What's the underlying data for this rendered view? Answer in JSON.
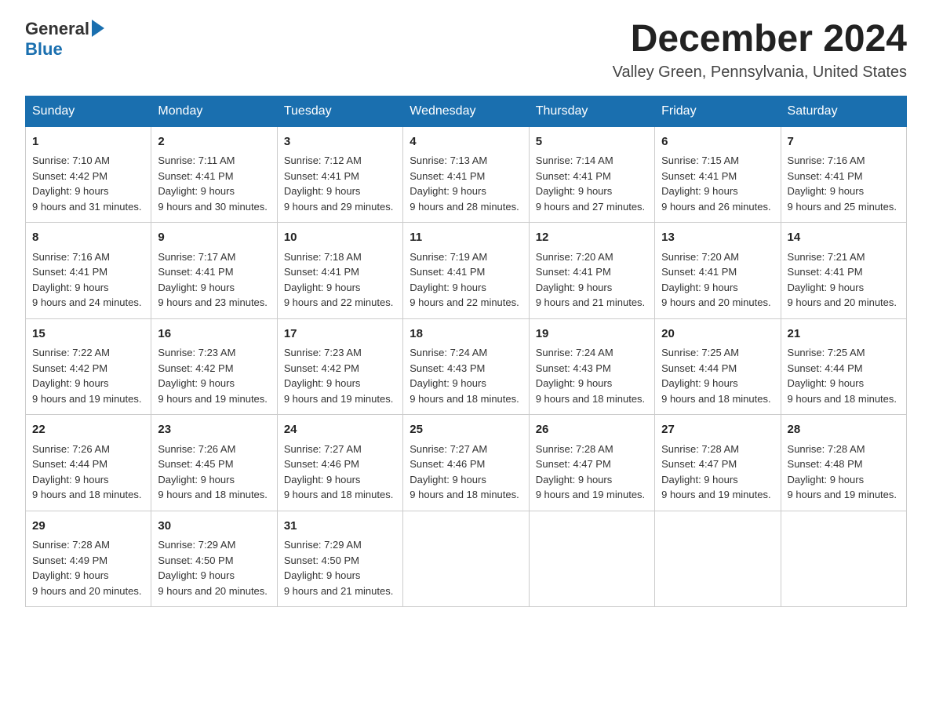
{
  "header": {
    "logo_general": "General",
    "logo_blue": "Blue",
    "month_title": "December 2024",
    "location": "Valley Green, Pennsylvania, United States"
  },
  "days_of_week": [
    "Sunday",
    "Monday",
    "Tuesday",
    "Wednesday",
    "Thursday",
    "Friday",
    "Saturday"
  ],
  "weeks": [
    [
      {
        "day": "1",
        "sunrise": "7:10 AM",
        "sunset": "4:42 PM",
        "daylight": "9 hours and 31 minutes."
      },
      {
        "day": "2",
        "sunrise": "7:11 AM",
        "sunset": "4:41 PM",
        "daylight": "9 hours and 30 minutes."
      },
      {
        "day": "3",
        "sunrise": "7:12 AM",
        "sunset": "4:41 PM",
        "daylight": "9 hours and 29 minutes."
      },
      {
        "day": "4",
        "sunrise": "7:13 AM",
        "sunset": "4:41 PM",
        "daylight": "9 hours and 28 minutes."
      },
      {
        "day": "5",
        "sunrise": "7:14 AM",
        "sunset": "4:41 PM",
        "daylight": "9 hours and 27 minutes."
      },
      {
        "day": "6",
        "sunrise": "7:15 AM",
        "sunset": "4:41 PM",
        "daylight": "9 hours and 26 minutes."
      },
      {
        "day": "7",
        "sunrise": "7:16 AM",
        "sunset": "4:41 PM",
        "daylight": "9 hours and 25 minutes."
      }
    ],
    [
      {
        "day": "8",
        "sunrise": "7:16 AM",
        "sunset": "4:41 PM",
        "daylight": "9 hours and 24 minutes."
      },
      {
        "day": "9",
        "sunrise": "7:17 AM",
        "sunset": "4:41 PM",
        "daylight": "9 hours and 23 minutes."
      },
      {
        "day": "10",
        "sunrise": "7:18 AM",
        "sunset": "4:41 PM",
        "daylight": "9 hours and 22 minutes."
      },
      {
        "day": "11",
        "sunrise": "7:19 AM",
        "sunset": "4:41 PM",
        "daylight": "9 hours and 22 minutes."
      },
      {
        "day": "12",
        "sunrise": "7:20 AM",
        "sunset": "4:41 PM",
        "daylight": "9 hours and 21 minutes."
      },
      {
        "day": "13",
        "sunrise": "7:20 AM",
        "sunset": "4:41 PM",
        "daylight": "9 hours and 20 minutes."
      },
      {
        "day": "14",
        "sunrise": "7:21 AM",
        "sunset": "4:41 PM",
        "daylight": "9 hours and 20 minutes."
      }
    ],
    [
      {
        "day": "15",
        "sunrise": "7:22 AM",
        "sunset": "4:42 PM",
        "daylight": "9 hours and 19 minutes."
      },
      {
        "day": "16",
        "sunrise": "7:23 AM",
        "sunset": "4:42 PM",
        "daylight": "9 hours and 19 minutes."
      },
      {
        "day": "17",
        "sunrise": "7:23 AM",
        "sunset": "4:42 PM",
        "daylight": "9 hours and 19 minutes."
      },
      {
        "day": "18",
        "sunrise": "7:24 AM",
        "sunset": "4:43 PM",
        "daylight": "9 hours and 18 minutes."
      },
      {
        "day": "19",
        "sunrise": "7:24 AM",
        "sunset": "4:43 PM",
        "daylight": "9 hours and 18 minutes."
      },
      {
        "day": "20",
        "sunrise": "7:25 AM",
        "sunset": "4:44 PM",
        "daylight": "9 hours and 18 minutes."
      },
      {
        "day": "21",
        "sunrise": "7:25 AM",
        "sunset": "4:44 PM",
        "daylight": "9 hours and 18 minutes."
      }
    ],
    [
      {
        "day": "22",
        "sunrise": "7:26 AM",
        "sunset": "4:44 PM",
        "daylight": "9 hours and 18 minutes."
      },
      {
        "day": "23",
        "sunrise": "7:26 AM",
        "sunset": "4:45 PM",
        "daylight": "9 hours and 18 minutes."
      },
      {
        "day": "24",
        "sunrise": "7:27 AM",
        "sunset": "4:46 PM",
        "daylight": "9 hours and 18 minutes."
      },
      {
        "day": "25",
        "sunrise": "7:27 AM",
        "sunset": "4:46 PM",
        "daylight": "9 hours and 18 minutes."
      },
      {
        "day": "26",
        "sunrise": "7:28 AM",
        "sunset": "4:47 PM",
        "daylight": "9 hours and 19 minutes."
      },
      {
        "day": "27",
        "sunrise": "7:28 AM",
        "sunset": "4:47 PM",
        "daylight": "9 hours and 19 minutes."
      },
      {
        "day": "28",
        "sunrise": "7:28 AM",
        "sunset": "4:48 PM",
        "daylight": "9 hours and 19 minutes."
      }
    ],
    [
      {
        "day": "29",
        "sunrise": "7:28 AM",
        "sunset": "4:49 PM",
        "daylight": "9 hours and 20 minutes."
      },
      {
        "day": "30",
        "sunrise": "7:29 AM",
        "sunset": "4:50 PM",
        "daylight": "9 hours and 20 minutes."
      },
      {
        "day": "31",
        "sunrise": "7:29 AM",
        "sunset": "4:50 PM",
        "daylight": "9 hours and 21 minutes."
      },
      null,
      null,
      null,
      null
    ]
  ],
  "labels": {
    "sunrise": "Sunrise:",
    "sunset": "Sunset:",
    "daylight": "Daylight: 9 hours"
  }
}
